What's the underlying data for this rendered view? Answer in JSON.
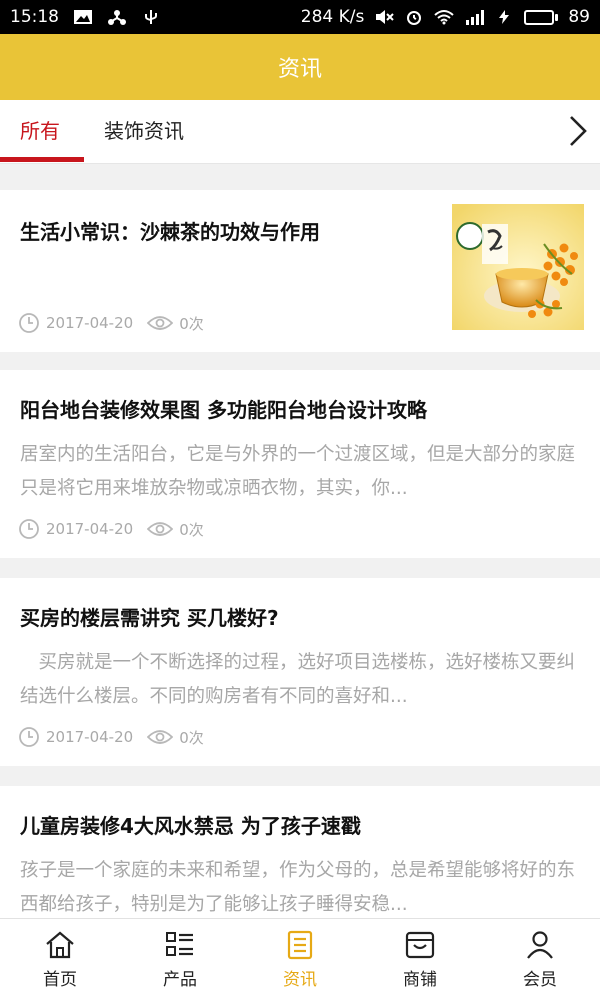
{
  "status": {
    "time": "15:18",
    "network_speed": "284 K/s",
    "battery_level": "89",
    "battery_percent": 89
  },
  "header": {
    "title": "资讯"
  },
  "tabs": [
    {
      "label": "所有",
      "active": true
    },
    {
      "label": "装饰资讯",
      "active": false
    }
  ],
  "articles": [
    {
      "title": "生活小常识：沙棘茶的功效与作用",
      "summary": "",
      "date": "2017-04-20",
      "views": "0次",
      "has_thumbnail": true
    },
    {
      "title": "阳台地台装修效果图 多功能阳台地台设计攻略",
      "summary": "居室内的生活阳台，它是与外界的一个过渡区域，但是大部分的家庭只是将它用来堆放杂物或凉晒衣物，其实，你...",
      "date": "2017-04-20",
      "views": "0次"
    },
    {
      "title": "买房的楼层需讲究 买几楼好?",
      "summary": "　买房就是一个不断选择的过程，选好项目选楼栋，选好楼栋又要纠结选什么楼层。不同的购房者有不同的喜好和...",
      "date": "2017-04-20",
      "views": "0次"
    },
    {
      "title": "儿童房装修4大风水禁忌 为了孩子速戳",
      "summary": "孩子是一个家庭的未来和希望，作为父母的，总是希望能够将好的东西都给孩子，特别是为了能够让孩子睡得安稳...",
      "date": "",
      "views": ""
    }
  ],
  "bottom_nav": [
    {
      "label": "首页",
      "icon": "home-icon",
      "active": false
    },
    {
      "label": "产品",
      "icon": "list-icon",
      "active": false
    },
    {
      "label": "资讯",
      "icon": "news-icon",
      "active": true
    },
    {
      "label": "商铺",
      "icon": "shop-icon",
      "active": false
    },
    {
      "label": "会员",
      "icon": "user-icon",
      "active": false
    }
  ],
  "colors": {
    "header_bg": "#e9c437",
    "tab_active": "#c8161d",
    "nav_active": "#e6a915",
    "summary_text": "#a7a7a7"
  }
}
